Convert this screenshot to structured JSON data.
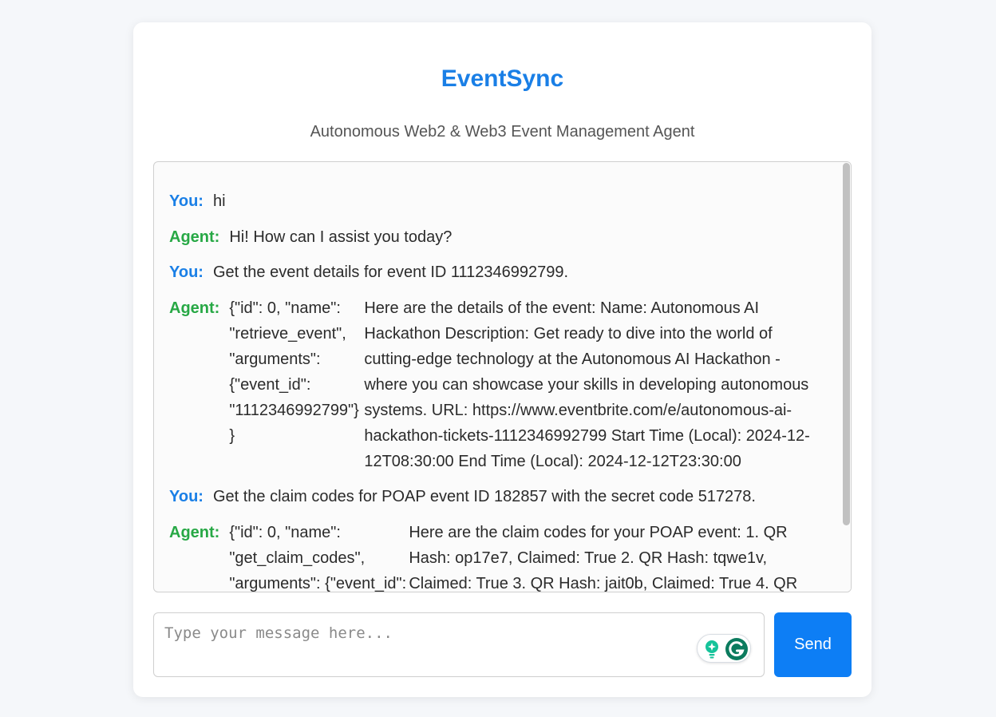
{
  "header": {
    "title": "EventSync",
    "subtitle": "Autonomous Web2 & Web3 Event Management Agent"
  },
  "chat": {
    "you_label": "You:",
    "agent_label": "Agent:",
    "messages": [
      {
        "sender": "you",
        "text": "hi"
      },
      {
        "sender": "agent",
        "text": "Hi! How can I assist you today?"
      },
      {
        "sender": "you",
        "text": "Get the event details for event ID 1112346992799."
      },
      {
        "sender": "agent",
        "function_call": "{\"id\": 0, \"name\": \"retrieve_event\", \"arguments\": {\"event_id\": \"1112346992799\"}}",
        "text": "Here are the details of the event: Name: Autonomous AI Hackathon Description: Get ready to dive into the world of cutting-edge technology at the Autonomous AI Hackathon - where you can showcase your skills in developing autonomous systems. URL: https://www.eventbrite.com/e/autonomous-ai-hackathon-tickets-1112346992799 Start Time (Local): 2024-12-12T08:30:00 End Time (Local): 2024-12-12T23:30:00"
      },
      {
        "sender": "you",
        "text": "Get the claim codes for POAP event ID 182857 with the secret code 517278."
      },
      {
        "sender": "agent",
        "function_call": "{\"id\": 0, \"name\": \"get_claim_codes\", \"arguments\": {\"event_id\":",
        "text": "Here are the claim codes for your POAP event: 1. QR Hash: op17e7, Claimed: True 2. QR Hash: tqwe1v, Claimed: True 3. QR Hash: jait0b, Claimed: True 4. QR"
      }
    ]
  },
  "composer": {
    "placeholder": "Type your message here...",
    "send_label": "Send"
  },
  "colors": {
    "accent": "#1a7fe6",
    "agent": "#27a845",
    "send_button": "#0d7ef5"
  }
}
